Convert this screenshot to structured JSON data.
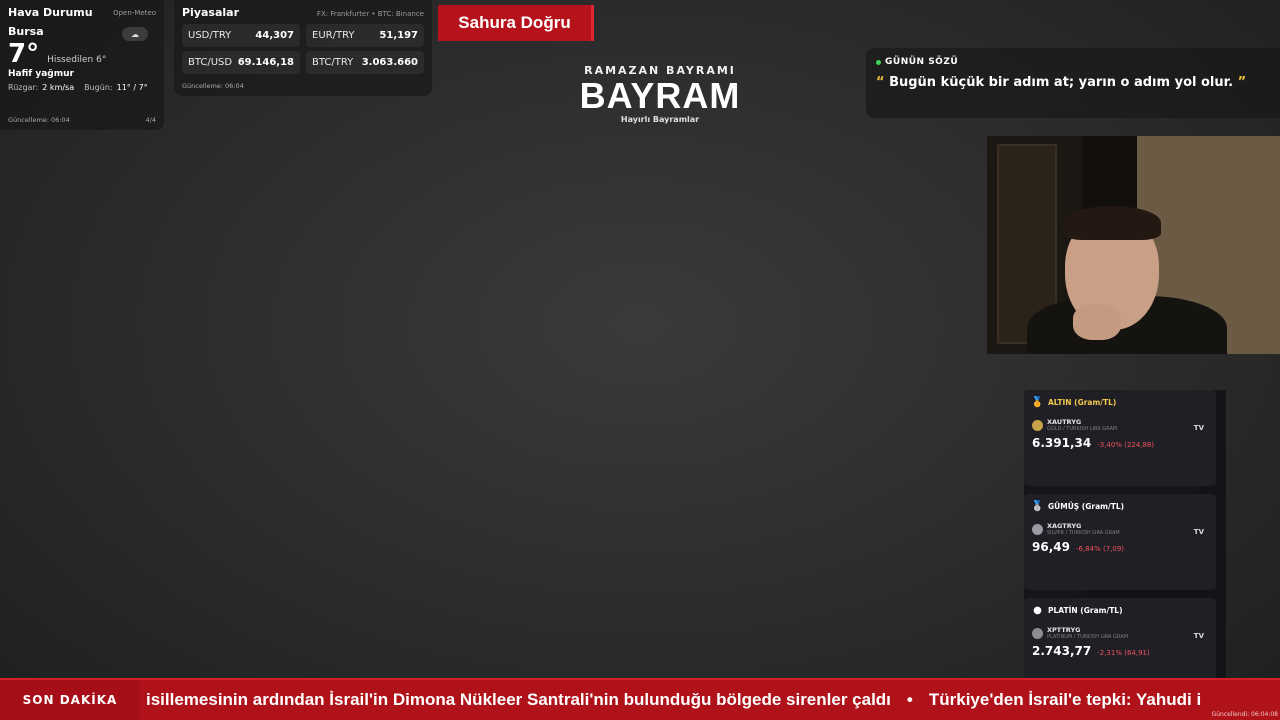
{
  "weather": {
    "title": "Hava Durumu",
    "source": "Open-Meteo",
    "city": "Bursa",
    "icon": "cloud-rain-icon",
    "icon_glyph": "☁",
    "temp": "7°",
    "feels": "Hissedilen 6°",
    "condition": "Hafif yağmur",
    "wind_label": "Rüzgar:",
    "wind_value": "2 km/sa",
    "today_label": "Bugün:",
    "today_value": "11° / 7°",
    "updated": "Güncelleme: 06:04",
    "page": "4/4"
  },
  "markets": {
    "title": "Piyasalar",
    "source": "FX: Frankfurter • BTC: Binance",
    "items": [
      {
        "name": "USD/TRY",
        "value": "44,307"
      },
      {
        "name": "EUR/TRY",
        "value": "51,197"
      },
      {
        "name": "BTC/USD",
        "value": "69.146,18"
      },
      {
        "name": "BTC/TRY",
        "value": "3.063.660"
      }
    ],
    "updated": "Güncelleme: 06:04"
  },
  "sahur": {
    "label": "Sahura Doğru"
  },
  "center_title": {
    "sup": "RAMAZAN BAYRAMI",
    "main": "BAYRAM",
    "sub": "Hayırlı Bayramlar"
  },
  "quote": {
    "label": "GÜNÜN SÖZÜ",
    "open_mark": "“",
    "text": "Bugün küçük bir adım at; yarın o adım yol olur.",
    "close_mark": "”"
  },
  "metals": {
    "cards": [
      {
        "title": "ALTIN (Gram/TL)",
        "symbol": "XAUTRYG",
        "desc": "GOLD / TURKISH LIRA GRAM",
        "price": "6.391,34",
        "change": "-3,40% (224,88)",
        "tv": "TV",
        "medal_glyph": "🏅"
      },
      {
        "title": "GÜMÜŞ (Gram/TL)",
        "symbol": "XAGTRYG",
        "desc": "SILVER / TURKISH LIRA GRAM",
        "price": "96,49",
        "change": "-6,84% (7,09)",
        "tv": "TV",
        "medal_glyph": "🥈"
      },
      {
        "title": "PLATİN (Gram/TL)",
        "symbol": "XPTTRYG",
        "desc": "PLATINUM / TURKISH LIRA GRAM",
        "price": "2.743,77",
        "change": "-2,31% (64,91)",
        "tv": "TV",
        "medal_glyph": "●"
      }
    ],
    "updated": "Güncellendi: 06:04:08"
  },
  "ticker": {
    "label": "SON DAKİKA",
    "items": [
      "isillemesinin ardından İsrail'in Dimona Nükleer Santrali'nin bulunduğu bölgede sirenler çaldı",
      "Türkiye'den İsrail'e tepki: Yahudi i"
    ],
    "separator": "•"
  },
  "colors": {
    "accent_red": "#b0121a",
    "gold": "#f2c94c",
    "negative": "#f0535f",
    "live_green": "#3fd45a"
  }
}
